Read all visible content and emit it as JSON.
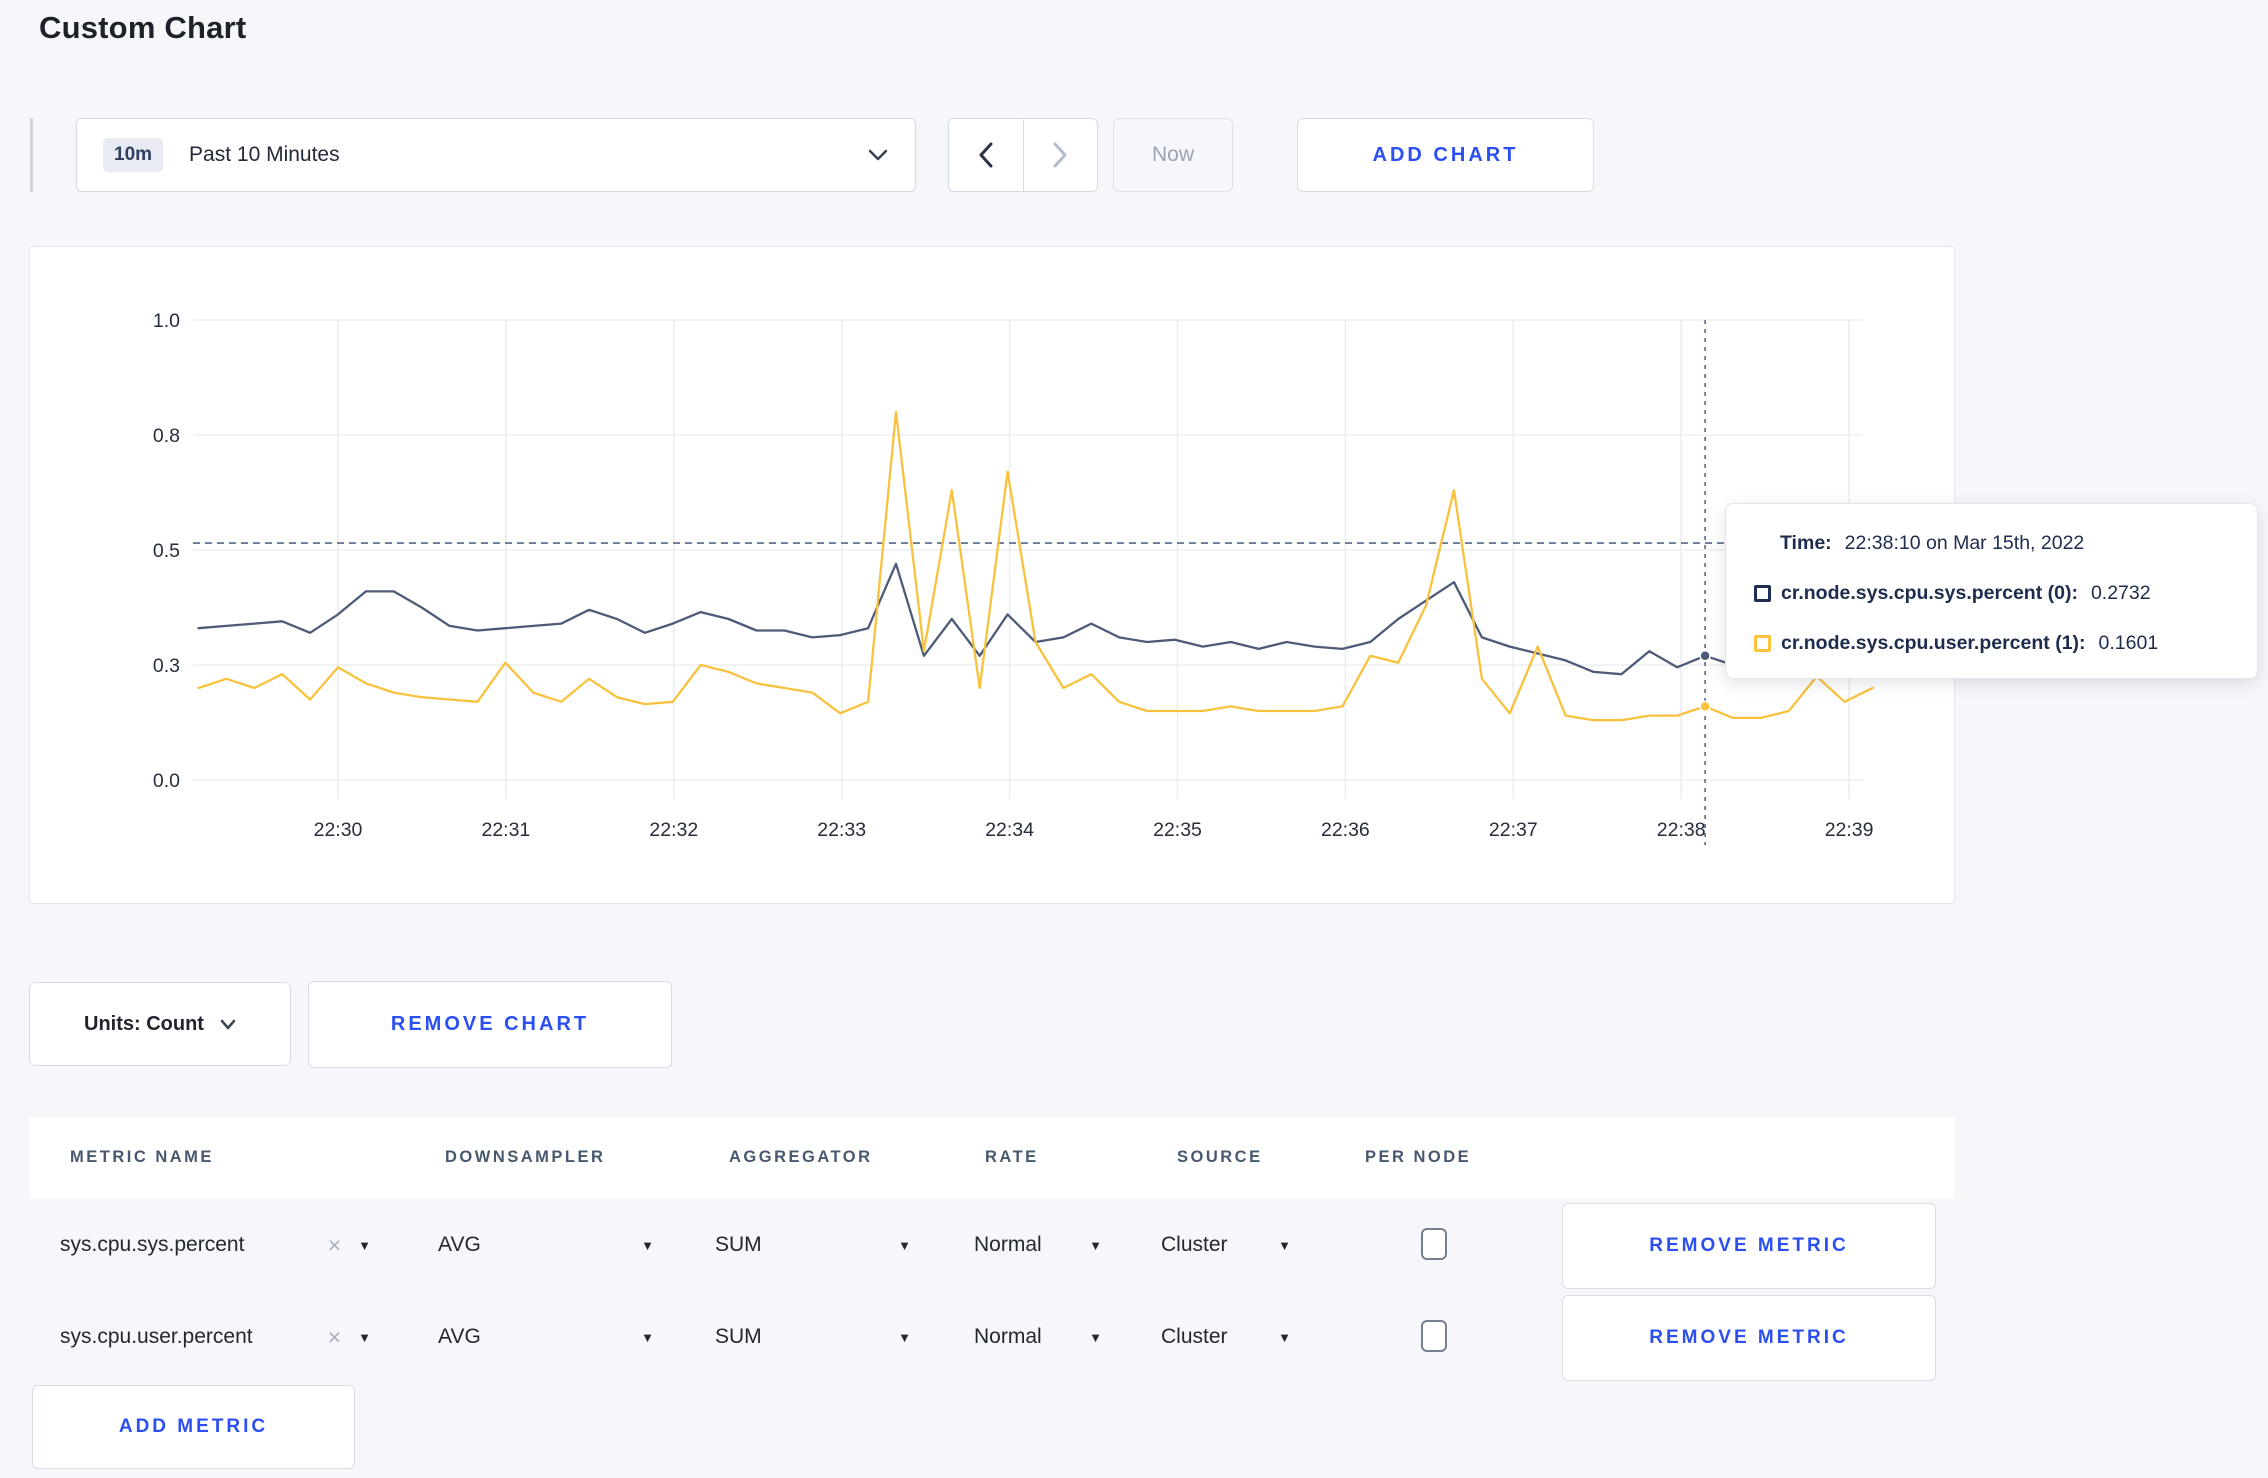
{
  "page": {
    "title": "Custom Chart"
  },
  "toolbar": {
    "time_selector": {
      "badge": "10m",
      "label": "Past 10 Minutes"
    },
    "now_button": "Now",
    "add_chart_button": "ADD CHART"
  },
  "chart": {
    "tooltip": {
      "time_label": "Time:",
      "time_value": "22:38:10 on Mar 15th, 2022",
      "series": [
        {
          "name": "cr.node.sys.cpu.sys.percent (0):",
          "value": "0.2732",
          "swatch_color": "#1e2d51"
        },
        {
          "name": "cr.node.sys.cpu.user.percent (1):",
          "value": "0.1601",
          "swatch_color": "#fcc33f"
        }
      ]
    }
  },
  "chart_data": {
    "type": "line",
    "title": "",
    "xlabel": "",
    "ylabel": "",
    "ylim": [
      0,
      1
    ],
    "grid": true,
    "legend_position": "tooltip",
    "x_tick_labels": [
      "22:30",
      "22:31",
      "22:32",
      "22:33",
      "22:34",
      "22:35",
      "22:36",
      "22:37",
      "22:38",
      "22:39"
    ],
    "y_tick_labels": [
      "0.0",
      "0.3",
      "0.5",
      "0.8",
      "1.0"
    ],
    "y_tick_values": [
      0,
      0.25,
      0.5,
      0.75,
      1.0
    ],
    "x_start_time": "22:29:10",
    "x_interval_seconds": 10,
    "series": [
      {
        "name": "cr.node.sys.cpu.sys.percent",
        "color": "#4d5b78",
        "values": [
          0.33,
          0.335,
          0.34,
          0.345,
          0.32,
          0.36,
          0.41,
          0.41,
          0.375,
          0.335,
          0.325,
          0.33,
          0.335,
          0.34,
          0.37,
          0.35,
          0.32,
          0.34,
          0.365,
          0.35,
          0.325,
          0.325,
          0.31,
          0.315,
          0.33,
          0.47,
          0.27,
          0.35,
          0.27,
          0.36,
          0.3,
          0.31,
          0.34,
          0.31,
          0.3,
          0.305,
          0.29,
          0.3,
          0.285,
          0.3,
          0.29,
          0.285,
          0.3,
          0.35,
          0.39,
          0.43,
          0.31,
          0.29,
          0.275,
          0.26,
          0.235,
          0.23,
          0.28,
          0.245,
          0.27,
          0.25,
          0.26,
          0.255,
          0.25,
          0.255,
          0.25
        ]
      },
      {
        "name": "cr.node.sys.cpu.user.percent",
        "color": "#f9c23e",
        "values": [
          0.2,
          0.22,
          0.2,
          0.23,
          0.175,
          0.245,
          0.21,
          0.19,
          0.18,
          0.175,
          0.17,
          0.255,
          0.19,
          0.17,
          0.22,
          0.18,
          0.165,
          0.17,
          0.25,
          0.235,
          0.21,
          0.2,
          0.19,
          0.145,
          0.17,
          0.8,
          0.28,
          0.63,
          0.2,
          0.67,
          0.3,
          0.2,
          0.23,
          0.17,
          0.15,
          0.15,
          0.15,
          0.16,
          0.15,
          0.15,
          0.15,
          0.16,
          0.27,
          0.255,
          0.38,
          0.63,
          0.22,
          0.145,
          0.29,
          0.14,
          0.13,
          0.13,
          0.14,
          0.14,
          0.16,
          0.135,
          0.135,
          0.15,
          0.225,
          0.17,
          0.2
        ]
      }
    ],
    "crosshair": {
      "x_index": 54,
      "y_value": 0.515,
      "time": "22:38:10"
    }
  },
  "units_bar": {
    "units_label": "Units: Count",
    "remove_chart_button": "REMOVE CHART"
  },
  "metrics_table": {
    "headers": [
      "METRIC NAME",
      "DOWNSAMPLER",
      "AGGREGATOR",
      "RATE",
      "SOURCE",
      "PER NODE"
    ],
    "remove_x": "×",
    "caret": "▼",
    "rows": [
      {
        "metric_name": "sys.cpu.sys.percent",
        "downsampler": "AVG",
        "aggregator": "SUM",
        "rate": "Normal",
        "source": "Cluster",
        "per_node_checked": false,
        "remove_button": "REMOVE METRIC"
      },
      {
        "metric_name": "sys.cpu.user.percent",
        "downsampler": "AVG",
        "aggregator": "SUM",
        "rate": "Normal",
        "source": "Cluster",
        "per_node_checked": false,
        "remove_button": "REMOVE METRIC"
      }
    ],
    "add_metric_button": "ADD METRIC"
  }
}
